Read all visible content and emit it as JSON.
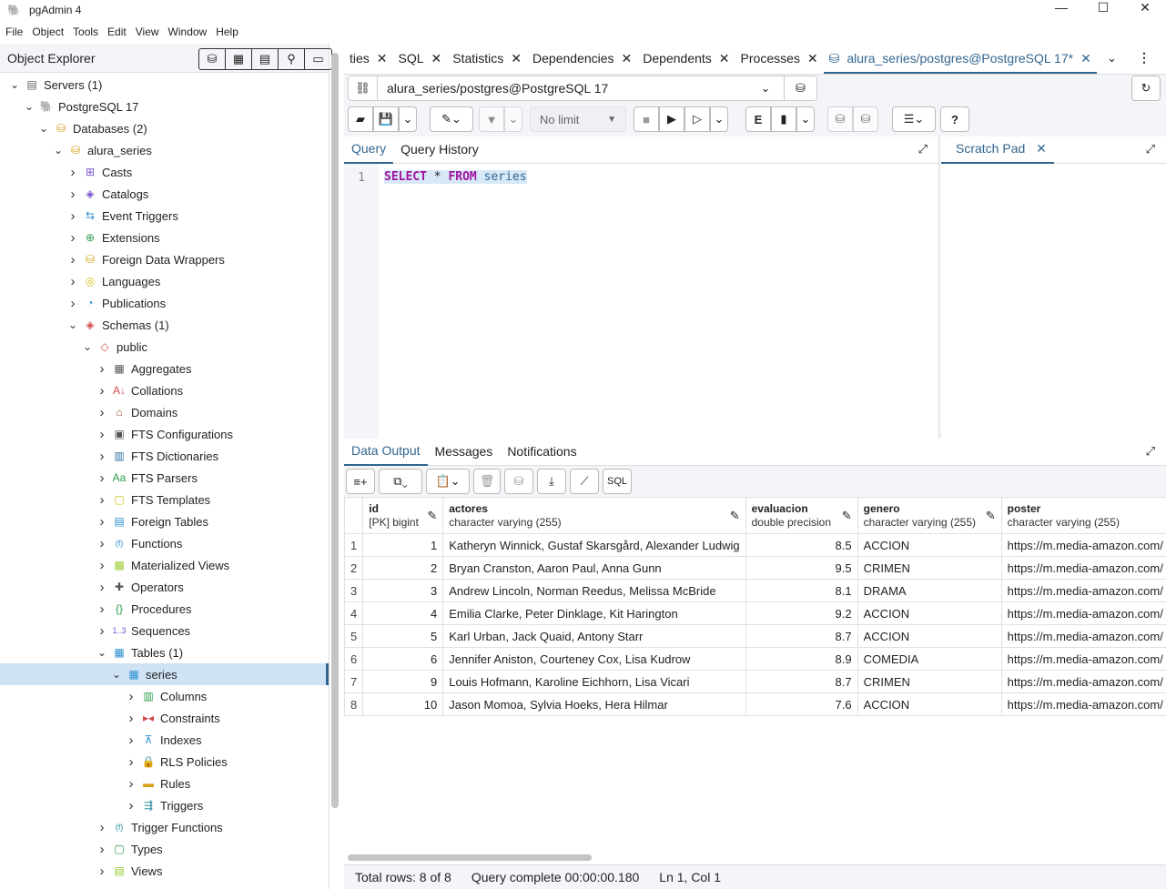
{
  "window": {
    "title": "pgAdmin 4",
    "minimize": "—",
    "maximize": "☐",
    "close": "✕"
  },
  "menu": [
    "File",
    "Object",
    "Tools",
    "Edit",
    "View",
    "Window",
    "Help"
  ],
  "object_explorer": {
    "title": "Object Explorer",
    "tree": [
      {
        "label": "Servers (1)",
        "level": 0,
        "open": true,
        "icon": "server-icon",
        "glyph": "▤",
        "color": "#666"
      },
      {
        "label": "PostgreSQL 17",
        "level": 1,
        "open": true,
        "icon": "elephant-icon",
        "glyph": "🐘",
        "color": "#336791"
      },
      {
        "label": "Databases (2)",
        "level": 2,
        "open": true,
        "icon": "databases-icon",
        "glyph": "⛁",
        "color": "#d4a017"
      },
      {
        "label": "alura_series",
        "level": 3,
        "open": true,
        "icon": "database-icon",
        "glyph": "⛁",
        "color": "#d4a017"
      },
      {
        "label": "Casts",
        "level": 4,
        "icon": "casts-icon",
        "glyph": "⊞",
        "color": "#7a4fd0"
      },
      {
        "label": "Catalogs",
        "level": 4,
        "icon": "catalogs-icon",
        "glyph": "◈",
        "color": "#7a4fd0"
      },
      {
        "label": "Event Triggers",
        "level": 4,
        "icon": "event-triggers-icon",
        "glyph": "⇆",
        "color": "#2a8fd0"
      },
      {
        "label": "Extensions",
        "level": 4,
        "icon": "extensions-icon",
        "glyph": "⊕",
        "color": "#2a9d4a"
      },
      {
        "label": "Foreign Data Wrappers",
        "level": 4,
        "icon": "fdw-icon",
        "glyph": "⛁",
        "color": "#d4a017"
      },
      {
        "label": "Languages",
        "level": 4,
        "icon": "languages-icon",
        "glyph": "◎",
        "color": "#d4c017"
      },
      {
        "label": "Publications",
        "level": 4,
        "icon": "publications-icon",
        "glyph": "◔",
        "color": "#2a8fd0"
      },
      {
        "label": "Schemas (1)",
        "level": 4,
        "open": true,
        "icon": "schemas-icon",
        "glyph": "◈",
        "color": "#d04a4a"
      },
      {
        "label": "public",
        "level": 5,
        "open": true,
        "icon": "schema-icon",
        "glyph": "◇",
        "color": "#d04a4a"
      },
      {
        "label": "Aggregates",
        "level": 6,
        "icon": "aggregates-icon",
        "glyph": "▦",
        "color": "#555"
      },
      {
        "label": "Collations",
        "level": 6,
        "icon": "collations-icon",
        "glyph": "A↓",
        "color": "#d04a4a"
      },
      {
        "label": "Domains",
        "level": 6,
        "icon": "domains-icon",
        "glyph": "⌂",
        "color": "#a0522d"
      },
      {
        "label": "FTS Configurations",
        "level": 6,
        "icon": "fts-configurations-icon",
        "glyph": "▣",
        "color": "#555"
      },
      {
        "label": "FTS Dictionaries",
        "level": 6,
        "icon": "fts-dictionaries-icon",
        "glyph": "▥",
        "color": "#2a6fa0"
      },
      {
        "label": "FTS Parsers",
        "level": 6,
        "icon": "fts-parsers-icon",
        "glyph": "Aa",
        "color": "#2a9d4a"
      },
      {
        "label": "FTS Templates",
        "level": 6,
        "icon": "fts-templates-icon",
        "glyph": "▢",
        "color": "#d4c017"
      },
      {
        "label": "Foreign Tables",
        "level": 6,
        "icon": "foreign-tables-icon",
        "glyph": "▤",
        "color": "#2a8fd0"
      },
      {
        "label": "Functions",
        "level": 6,
        "icon": "functions-icon",
        "glyph": "(f)",
        "color": "#2a8fd0"
      },
      {
        "label": "Materialized Views",
        "level": 6,
        "icon": "materialized-views-icon",
        "glyph": "▩",
        "color": "#9acd32"
      },
      {
        "label": "Operators",
        "level": 6,
        "icon": "operators-icon",
        "glyph": "✚",
        "color": "#555"
      },
      {
        "label": "Procedures",
        "level": 6,
        "icon": "procedures-icon",
        "glyph": "{}",
        "color": "#2a9d4a"
      },
      {
        "label": "Sequences",
        "level": 6,
        "icon": "sequences-icon",
        "glyph": "1..3",
        "color": "#7a4fd0"
      },
      {
        "label": "Tables (1)",
        "level": 6,
        "open": true,
        "icon": "tables-icon",
        "glyph": "▦",
        "color": "#2a8fd0"
      },
      {
        "label": "series",
        "level": 7,
        "open": true,
        "selected": true,
        "icon": "table-icon",
        "glyph": "▦",
        "color": "#2a8fd0"
      },
      {
        "label": "Columns",
        "level": 8,
        "icon": "columns-icon",
        "glyph": "▥",
        "color": "#2a9d4a"
      },
      {
        "label": "Constraints",
        "level": 8,
        "icon": "constraints-icon",
        "glyph": "▸◂",
        "color": "#d04a4a"
      },
      {
        "label": "Indexes",
        "level": 8,
        "icon": "indexes-icon",
        "glyph": "⊼",
        "color": "#2a8fd0"
      },
      {
        "label": "RLS Policies",
        "level": 8,
        "icon": "lock-icon",
        "glyph": "🔒",
        "color": "#2a9d4a"
      },
      {
        "label": "Rules",
        "level": 8,
        "icon": "rules-icon",
        "glyph": "▬",
        "color": "#d4a017"
      },
      {
        "label": "Triggers",
        "level": 8,
        "icon": "triggers-icon",
        "glyph": "⇶",
        "color": "#2a8fa0"
      },
      {
        "label": "Trigger Functions",
        "level": 6,
        "icon": "trigger-functions-icon",
        "glyph": "(f)",
        "color": "#2a8fa0"
      },
      {
        "label": "Types",
        "level": 6,
        "icon": "types-icon",
        "glyph": "▢",
        "color": "#2a9d4a"
      },
      {
        "label": "Views",
        "level": 6,
        "icon": "views-icon",
        "glyph": "▤",
        "color": "#9acd32"
      }
    ]
  },
  "tabs": [
    {
      "label": "ties"
    },
    {
      "label": "SQL"
    },
    {
      "label": "Statistics"
    },
    {
      "label": "Dependencies"
    },
    {
      "label": "Dependents"
    },
    {
      "label": "Processes"
    },
    {
      "label": "alura_series/postgres@PostgreSQL 17*",
      "active": true
    }
  ],
  "connection": {
    "value": "alura_series/postgres@PostgreSQL 17"
  },
  "toolbar": {
    "limit": "No limit"
  },
  "query": {
    "tabs": [
      "Query",
      "Query History"
    ],
    "line": "1",
    "keyword1": "SELECT",
    "star": " *",
    "keyword2": "FROM",
    "table": " series"
  },
  "scratch": {
    "title": "Scratch Pad"
  },
  "output": {
    "tabs": [
      "Data Output",
      "Messages",
      "Notifications"
    ],
    "columns": [
      {
        "name": "id",
        "type": "[PK] bigint"
      },
      {
        "name": "actores",
        "type": "character varying (255)"
      },
      {
        "name": "evaluacion",
        "type": "double precision"
      },
      {
        "name": "genero",
        "type": "character varying (255)"
      },
      {
        "name": "poster",
        "type": "character varying (255)"
      }
    ],
    "rows": [
      [
        "1",
        "1",
        "Katheryn Winnick, Gustaf Skarsgård, Alexander Ludwig",
        "8.5",
        "ACCION",
        "https://m.media-amazon.com/"
      ],
      [
        "2",
        "2",
        "Bryan Cranston, Aaron Paul, Anna Gunn",
        "9.5",
        "CRIMEN",
        "https://m.media-amazon.com/"
      ],
      [
        "3",
        "3",
        "Andrew Lincoln, Norman Reedus, Melissa McBride",
        "8.1",
        "DRAMA",
        "https://m.media-amazon.com/"
      ],
      [
        "4",
        "4",
        "Emilia Clarke, Peter Dinklage, Kit Harington",
        "9.2",
        "ACCION",
        "https://m.media-amazon.com/"
      ],
      [
        "5",
        "5",
        "Karl Urban, Jack Quaid, Antony Starr",
        "8.7",
        "ACCION",
        "https://m.media-amazon.com/"
      ],
      [
        "6",
        "6",
        "Jennifer Aniston, Courteney Cox, Lisa Kudrow",
        "8.9",
        "COMEDIA",
        "https://m.media-amazon.com/"
      ],
      [
        "7",
        "9",
        "Louis Hofmann, Karoline Eichhorn, Lisa Vicari",
        "8.7",
        "CRIMEN",
        "https://m.media-amazon.com/"
      ],
      [
        "8",
        "10",
        "Jason Momoa, Sylvia Hoeks, Hera Hilmar",
        "7.6",
        "ACCION",
        "https://m.media-amazon.com/"
      ]
    ]
  },
  "status": {
    "rows": "Total rows: 8 of 8",
    "query": "Query complete 00:00:00.180",
    "cursor": "Ln 1, Col 1"
  }
}
